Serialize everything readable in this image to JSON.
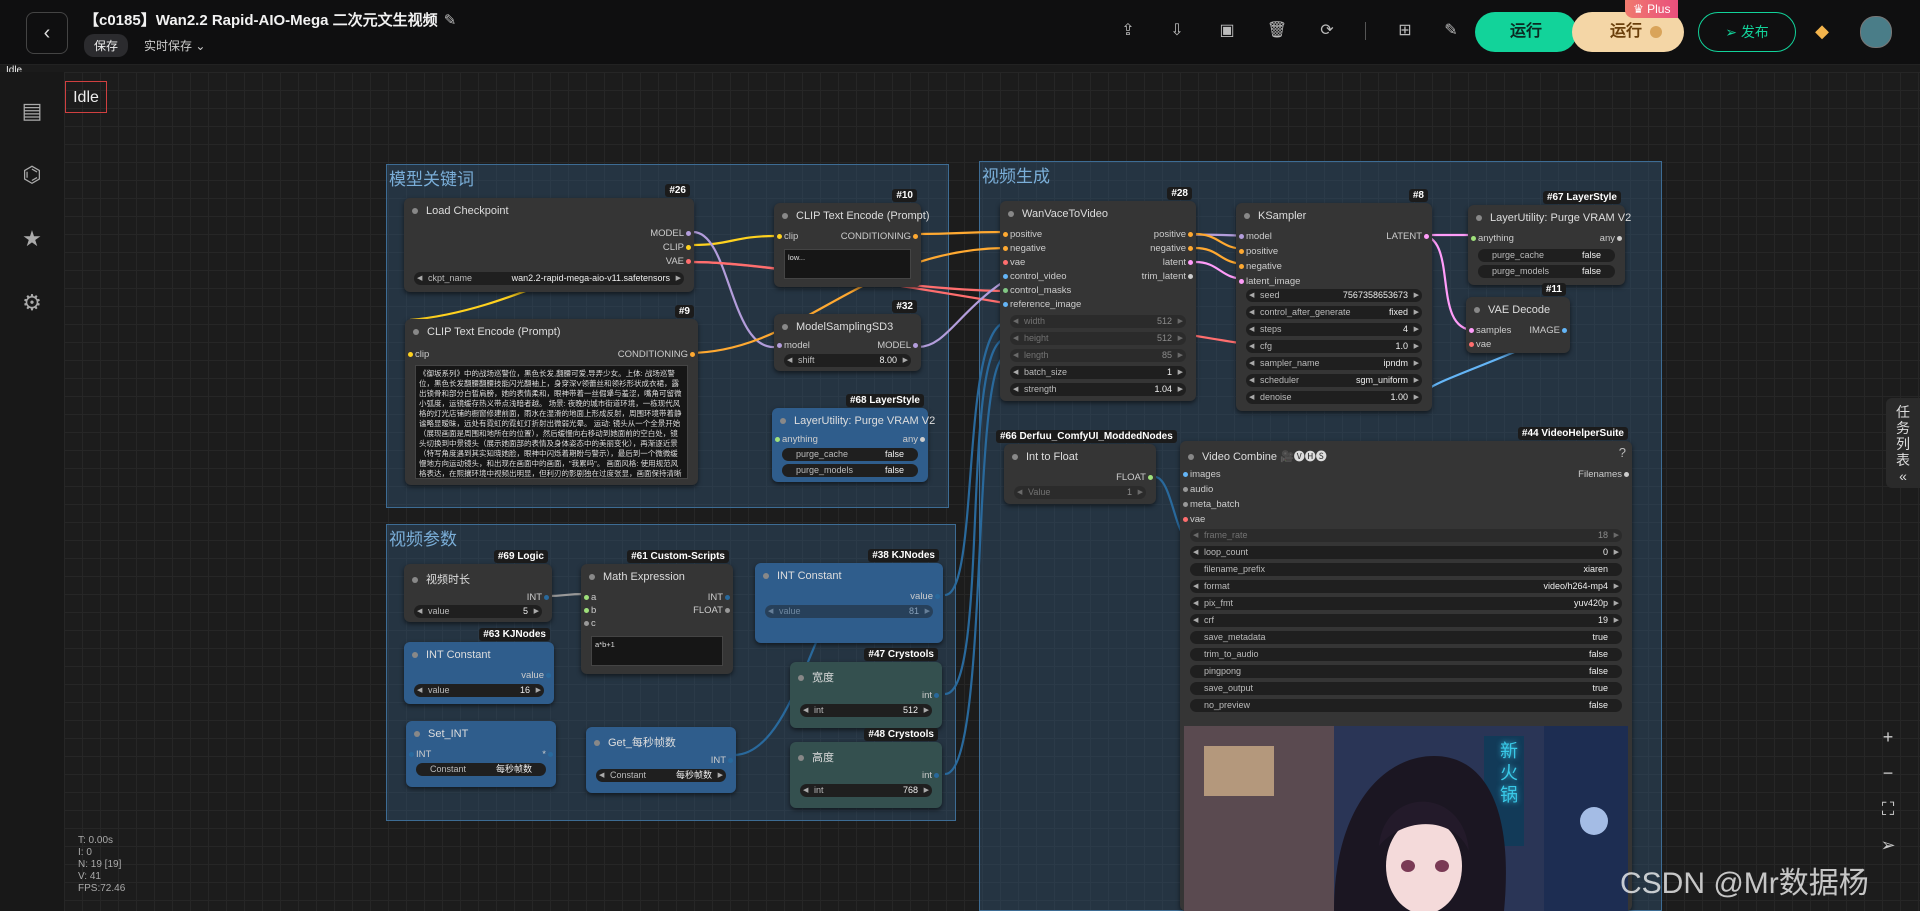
{
  "app": {
    "title": "【c0185】Wan2.2 Rapid-AIO-Mega 二次元文生视频",
    "save_label": "保存",
    "autosave_label": "实时保存",
    "run_label": "运行",
    "run_plus_label": "运行",
    "plus_badge": "Plus",
    "publish_label": "发布",
    "status_small": "Idle",
    "status_box": "Idle",
    "queue_panel_label": "任务列表",
    "watermark": "CSDN @Mr数据杨"
  },
  "toolbar_icons": [
    "upload-icon",
    "download-icon",
    "image-icon",
    "trash-icon",
    "refresh-icon",
    "grid-icon",
    "edit-box-icon"
  ],
  "sidebar_icons": [
    "document-icon",
    "hierarchy-icon",
    "star-icon",
    "settings-icon"
  ],
  "stats": [
    "T: 0.00s",
    "I: 0",
    "N: 19 [19]",
    "V: 41",
    "FPS:72.46"
  ],
  "groups": {
    "model_keywords": "模型关键词",
    "video_params": "视频参数",
    "video_gen": "视频生成"
  },
  "nodes": {
    "load_checkpoint": {
      "tag": "#26",
      "title": "Load Checkpoint",
      "outputs": [
        "MODEL",
        "CLIP",
        "VAE"
      ],
      "widget_label": "ckpt_name",
      "widget_value": "wan2.2-rapid-mega-aio-v11.safetensors"
    },
    "clip_pos": {
      "tag": "#9",
      "title": "CLIP Text Encode (Prompt)",
      "input": "clip",
      "output": "CONDITIONING",
      "text": "《御坂系列》中的战场巡警位，黑色长发,翻腰可爱,导弄少女。上体: 战场巡警位，黑色长发翻腰翻腰技能闪光翻袖上，身穿深V领蕾丝和领衫形状成衣裙，露出锁骨和部分白皙肩膀，她的表情柔和，眼神带着一丝倔犟与羞涩，嘴角可留微小弧度，运镜缓存热义带点浅暗者越。\n场景: 夜晚的城市街道环境，一栋现代风格的灯光店铺的橱窗修建前面，雨水在湿滑的地面上形成反射，周围环境带着静谧略显暧昧，远处有霓虹的霓虹灯折射出微弱光晕。\n运动: 镜头从一个全景开始（展现画面是周围和地所在的位置），然后缓慢向右移动到她面前的空白处，镜头切换到中景镜头（展示她面部的表情及身体姿态中的美丽变化），再渐逐近景（特写角度遇到其实知晓她脸，眼神中闪烁着期盼与警示），最后到一个微微缓慢地方向运动镜头，和出现在画面中的画面，\"我累吗\"。\n画面风格: 使用规范风格表达，在熙攘环境中视频出明显，但利刃的影剧独在过度张显，画面保持清晰细节。\n风格位: 反差喉咙风格，结合微气色彩表达，视频角色上面整体使用（数据统计）。"
    },
    "clip_neg": {
      "tag": "#10",
      "title": "CLIP Text Encode (Prompt)",
      "input": "clip",
      "output": "CONDITIONING",
      "text": "low..."
    },
    "model_sampling": {
      "tag": "#32",
      "title": "ModelSamplingSD3",
      "input": "model",
      "output": "MODEL",
      "widget_label": "shift",
      "widget_value": "8.00"
    },
    "purge_vram_1": {
      "tag": "#68 LayerStyle",
      "title": "LayerUtility: Purge VRAM V2",
      "input": "anything",
      "output": "any",
      "widgets": [
        {
          "label": "purge_cache",
          "value": "false"
        },
        {
          "label": "purge_models",
          "value": "false"
        }
      ]
    },
    "wan_vace": {
      "tag": "#28",
      "title": "WanVaceToVideo",
      "inputs": [
        "positive",
        "negative",
        "vae",
        "control_video",
        "control_masks",
        "reference_image"
      ],
      "outputs": [
        "positive",
        "negative",
        "latent",
        "trim_latent"
      ],
      "widgets": [
        {
          "label": "width",
          "value": "512"
        },
        {
          "label": "height",
          "value": "512"
        },
        {
          "label": "length",
          "value": "85"
        },
        {
          "label": "batch_size",
          "value": "1"
        },
        {
          "label": "strength",
          "value": "1.04"
        }
      ]
    },
    "ksampler": {
      "tag": "#8",
      "title": "KSampler",
      "inputs": [
        "model",
        "positive",
        "negative",
        "latent_image"
      ],
      "output": "LATENT",
      "widgets": [
        {
          "label": "seed",
          "value": "7567358653673"
        },
        {
          "label": "control_after_generate",
          "value": "fixed"
        },
        {
          "label": "steps",
          "value": "4"
        },
        {
          "label": "cfg",
          "value": "1.0"
        },
        {
          "label": "sampler_name",
          "value": "ipndm"
        },
        {
          "label": "scheduler",
          "value": "sgm_uniform"
        },
        {
          "label": "denoise",
          "value": "1.00"
        }
      ]
    },
    "purge_vram_2": {
      "tag": "#67 LayerStyle",
      "title": "LayerUtility: Purge VRAM V2",
      "input": "anything",
      "output": "any",
      "widgets": [
        {
          "label": "purge_cache",
          "value": "false"
        },
        {
          "label": "purge_models",
          "value": "false"
        }
      ]
    },
    "vae_decode": {
      "tag": "#11",
      "title": "VAE Decode",
      "inputs": [
        "samples",
        "vae"
      ],
      "output": "IMAGE"
    },
    "int_to_float": {
      "tag": "#66 Derfuu_ComfyUI_ModdedNodes",
      "title": "Int to Float",
      "output": "FLOAT",
      "widget_label": "Value",
      "widget_value": "1"
    },
    "video_combine": {
      "tag": "#44 VideoHelperSuite",
      "title": "Video Combine",
      "icons": "🎥🅥🅗🅢",
      "help": "?",
      "inputs": [
        "images",
        "audio",
        "meta_batch",
        "vae"
      ],
      "output": "Filenames",
      "widgets": [
        {
          "label": "frame_rate",
          "value": "18"
        },
        {
          "label": "loop_count",
          "value": "0"
        },
        {
          "label": "filename_prefix",
          "value": "xiaren"
        },
        {
          "label": "format",
          "value": "video/h264-mp4"
        },
        {
          "label": "pix_fmt",
          "value": "yuv420p"
        },
        {
          "label": "crf",
          "value": "19"
        },
        {
          "label": "save_metadata",
          "value": "true"
        },
        {
          "label": "trim_to_audio",
          "value": "false"
        },
        {
          "label": "pingpong",
          "value": "false"
        },
        {
          "label": "save_output",
          "value": "true"
        },
        {
          "label": "no_preview",
          "value": "false"
        }
      ],
      "preview_sign": "新火锅"
    },
    "video_duration": {
      "tag": "#69 Logic",
      "title": "视频时长",
      "output": "INT",
      "widget_label": "value",
      "widget_value": "5"
    },
    "math_expr": {
      "tag": "#61 Custom-Scripts",
      "title": "Math Expression",
      "inputs": [
        "a",
        "b",
        "c"
      ],
      "outputs": [
        "INT",
        "FLOAT"
      ],
      "expression": "a*b+1"
    },
    "int_const_38": {
      "tag": "#38 KJNodes",
      "title": "INT Constant",
      "output": "value",
      "widget_label": "value",
      "widget_value": "81"
    },
    "int_const_63": {
      "tag": "#63 KJNodes",
      "title": "INT Constant",
      "output": "value",
      "widget_label": "value",
      "widget_value": "16"
    },
    "set_int": {
      "title": "Set_INT",
      "input": "INT",
      "output": "*",
      "widget_label": "Constant",
      "widget_value": "每秒帧数"
    },
    "get_fps": {
      "title": "Get_每秒帧数",
      "output": "INT",
      "widget_label": "Constant",
      "widget_value": "每秒帧数"
    },
    "width_node": {
      "tag": "#47 Crystools",
      "title": "宽度",
      "output": "int",
      "widget_label": "int",
      "widget_value": "512"
    },
    "height_node": {
      "tag": "#48 Crystools",
      "title": "高度",
      "output": "int",
      "widget_label": "int",
      "widget_value": "768"
    }
  },
  "colors": {
    "run": "#12d39a",
    "run_plus": "#f4d6a6",
    "group": "#345c80",
    "clip_link": "#ffd21f",
    "model_link": "#b39ddb",
    "vae_link": "#ff6e6e",
    "latent_link": "#ff9cf9",
    "cond_link": "#ffa931",
    "int_link": "#29699c",
    "image_link": "#64b5f6"
  }
}
